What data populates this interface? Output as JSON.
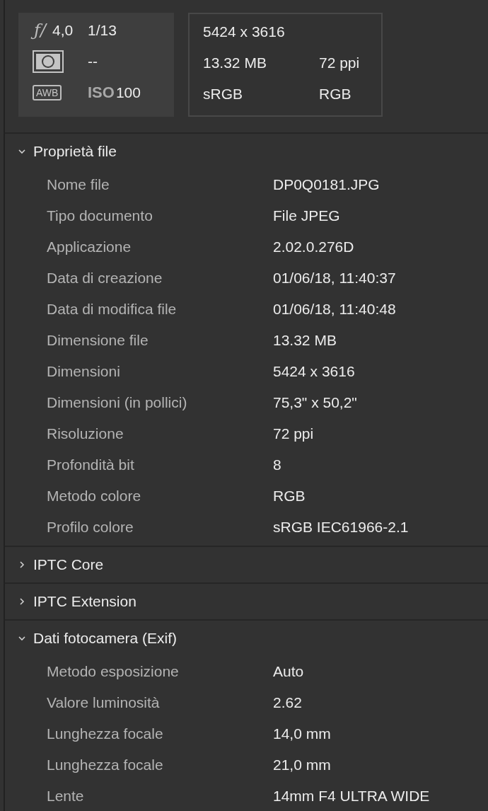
{
  "summary": {
    "aperture_symbol": "ƒ/",
    "aperture": "4,0",
    "shutter": "1/13",
    "metering": "--",
    "wb_label": "AWB",
    "iso_label": "ISO",
    "iso": "100",
    "dimensions": "5424 x 3616",
    "size": "13.32 MB",
    "resolution": "72 ppi",
    "profile": "sRGB",
    "mode": "RGB"
  },
  "sections": [
    {
      "title": "Proprietà file",
      "expanded": true,
      "rows": [
        {
          "label": "Nome file",
          "value": "DP0Q0181.JPG"
        },
        {
          "label": "Tipo documento",
          "value": "File JPEG"
        },
        {
          "label": "Applicazione",
          "value": "2.02.0.276D"
        },
        {
          "label": "Data di creazione",
          "value": "01/06/18, 11:40:37"
        },
        {
          "label": "Data di modifica file",
          "value": "01/06/18, 11:40:48"
        },
        {
          "label": "Dimensione file",
          "value": "13.32 MB"
        },
        {
          "label": "Dimensioni",
          "value": "5424 x 3616"
        },
        {
          "label": "Dimensioni (in pollici)",
          "value": "75,3\" x 50,2\""
        },
        {
          "label": "Risoluzione",
          "value": "72 ppi"
        },
        {
          "label": "Profondità bit",
          "value": "8"
        },
        {
          "label": "Metodo colore",
          "value": "RGB"
        },
        {
          "label": "Profilo colore",
          "value": "sRGB IEC61966-2.1"
        }
      ]
    },
    {
      "title": "IPTC Core",
      "expanded": false
    },
    {
      "title": "IPTC Extension",
      "expanded": false
    },
    {
      "title": "Dati fotocamera (Exif)",
      "expanded": true,
      "rows": [
        {
          "label": "Metodo esposizione",
          "value": "Auto"
        },
        {
          "label": "Valore luminosità",
          "value": "2.62"
        },
        {
          "label": "Lunghezza focale",
          "value": "14,0 mm"
        },
        {
          "label": "Lunghezza focale",
          "value": "21,0 mm"
        },
        {
          "label": "Lente",
          "value": "14mm F4 ULTRA WIDE"
        }
      ]
    }
  ]
}
